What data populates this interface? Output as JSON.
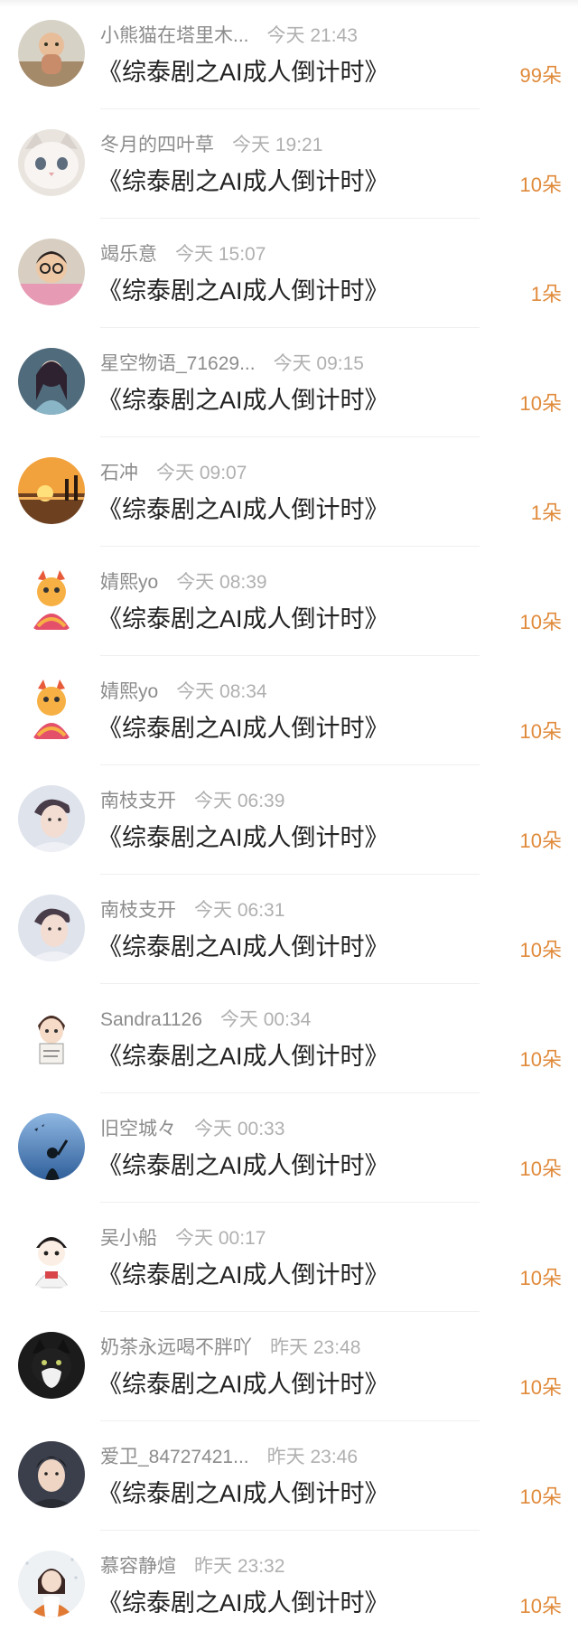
{
  "gift_list": {
    "items": [
      {
        "username": "小熊猫在塔里木...",
        "time": "今天 21:43",
        "title": "《综泰剧之AI成人倒计时》",
        "amount": "99朵",
        "avatar_icon": "toddler-photo-icon"
      },
      {
        "username": "冬月的四叶草",
        "time": "今天 19:21",
        "title": "《综泰剧之AI成人倒计时》",
        "amount": "10朵",
        "avatar_icon": "white-cat-icon"
      },
      {
        "username": "竭乐意",
        "time": "今天 15:07",
        "title": "《综泰剧之AI成人倒计时》",
        "amount": "1朵",
        "avatar_icon": "child-with-glasses-icon"
      },
      {
        "username": "星空物语_71629...",
        "time": "今天 09:15",
        "title": "《综泰剧之AI成人倒计时》",
        "amount": "10朵",
        "avatar_icon": "anime-girl-icon"
      },
      {
        "username": "石冲",
        "time": "今天 09:07",
        "title": "《综泰剧之AI成人倒计时》",
        "amount": "1朵",
        "avatar_icon": "sunset-sea-icon"
      },
      {
        "username": "婧熙yo",
        "time": "今天 08:39",
        "title": "《综泰剧之AI成人倒计时》",
        "amount": "10朵",
        "avatar_icon": "cartoon-dragon-icon"
      },
      {
        "username": "婧熙yo",
        "time": "今天 08:34",
        "title": "《综泰剧之AI成人倒计时》",
        "amount": "10朵",
        "avatar_icon": "cartoon-dragon-icon"
      },
      {
        "username": "南枝支开",
        "time": "今天 06:39",
        "title": "《综泰剧之AI成人倒计时》",
        "amount": "10朵",
        "avatar_icon": "portrait-man-icon"
      },
      {
        "username": "南枝支开",
        "time": "今天 06:31",
        "title": "《综泰剧之AI成人倒计时》",
        "amount": "10朵",
        "avatar_icon": "portrait-man-icon"
      },
      {
        "username": "Sandra1126",
        "time": "今天 00:34",
        "title": "《综泰剧之AI成人倒计时》",
        "amount": "10朵",
        "avatar_icon": "cartoon-boy-sign-icon"
      },
      {
        "username": "旧空城々",
        "time": "今天 00:33",
        "title": "《综泰剧之AI成人倒计时》",
        "amount": "10朵",
        "avatar_icon": "blue-sky-silhouette-icon"
      },
      {
        "username": "吴小船",
        "time": "今天 00:17",
        "title": "《综泰剧之AI成人倒计时》",
        "amount": "10朵",
        "avatar_icon": "cartoon-character-icon"
      },
      {
        "username": "奶茶永远喝不胖吖",
        "time": "昨天 23:48",
        "title": "《综泰剧之AI成人倒计时》",
        "amount": "10朵",
        "avatar_icon": "black-white-cat-icon"
      },
      {
        "username": "爱卫_84727421...",
        "time": "昨天 23:46",
        "title": "《综泰剧之AI成人倒计时》",
        "amount": "10朵",
        "avatar_icon": "portrait-young-man-icon"
      },
      {
        "username": "慕容静煊",
        "time": "昨天 23:32",
        "title": "《综泰剧之AI成人倒计时》",
        "amount": "10朵",
        "avatar_icon": "winter-girl-icon"
      }
    ]
  },
  "colors": {
    "amount": "#e08a3a",
    "username": "#8c8c8c",
    "time": "#b0b0b0",
    "title": "#222222"
  }
}
